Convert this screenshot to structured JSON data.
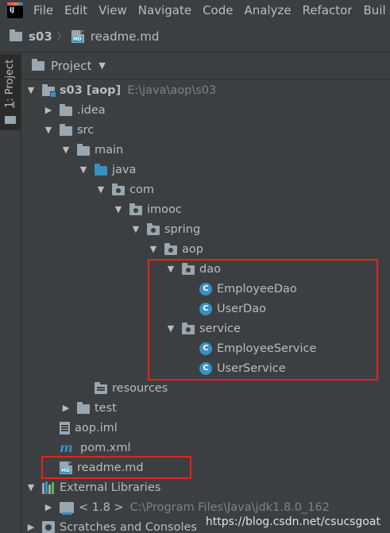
{
  "menu": [
    "File",
    "Edit",
    "View",
    "Navigate",
    "Code",
    "Analyze",
    "Refactor",
    "Buil"
  ],
  "app_logo_text": "IJ",
  "breadcrumb": {
    "project": "s03",
    "file": "readme.md",
    "file_icon_text": "MD"
  },
  "tool_stripe": {
    "number": "1",
    "label": ": Project"
  },
  "panel": {
    "title": "Project",
    "dropdown": "▼"
  },
  "tree": {
    "root": {
      "name": "s03",
      "module": "[aop]",
      "path": "E:\\java\\aop\\s03"
    },
    "idea": ".idea",
    "src": "src",
    "main": "main",
    "java": "java",
    "com": "com",
    "imooc": "imooc",
    "spring": "spring",
    "aop": "aop",
    "dao": "dao",
    "employee_dao": "EmployeeDao",
    "user_dao": "UserDao",
    "service": "service",
    "employee_service": "EmployeeService",
    "user_service": "UserService",
    "resources": "resources",
    "test": "test",
    "aop_iml": "aop.iml",
    "pom": "pom.xml",
    "readme": "readme.md",
    "external_libraries": "External Libraries",
    "jdk_name": "< 1.8 >",
    "jdk_path": "C:\\Program Files\\Java\\jdk1.8.0_162",
    "scratches": "Scratches and Consoles",
    "class_glyph": "C"
  },
  "watermark": "https://blog.csdn.net/csucsgoat",
  "colors": {
    "background": "#3c3f41",
    "text": "#bbbbbb",
    "dim_text": "#808080",
    "folder_blue": "#3592c4",
    "folder_grey": "#9aa7b0",
    "highlight_red": "#e8211d"
  }
}
